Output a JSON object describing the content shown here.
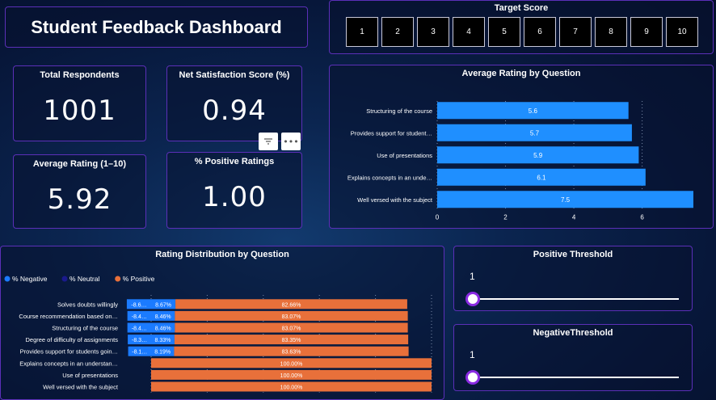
{
  "dashboard": {
    "title": "Student Feedback Dashboard"
  },
  "kpis": {
    "respondents": {
      "label": "Total Respondents",
      "value": "1001"
    },
    "nss": {
      "label": "Net Satisfaction Score (%)",
      "value": "0.94"
    },
    "avg_rating": {
      "label": "Average Rating (1–10)",
      "value": "5.92"
    },
    "pos_ratings": {
      "label": "% Positive Ratings",
      "value": "1.00"
    }
  },
  "visual_tools": {
    "filter_icon": "filter-icon",
    "more_icon": "more-options-icon",
    "more_label": "•••"
  },
  "target_score": {
    "title": "Target Score",
    "options": [
      "1",
      "2",
      "3",
      "4",
      "5",
      "6",
      "7",
      "8",
      "9",
      "10"
    ]
  },
  "avg_by_question": {
    "title": "Average Rating by Question",
    "chart_data": {
      "type": "bar",
      "orientation": "horizontal",
      "categories": [
        "Structuring of the course",
        "Provides support for student…",
        "Use of presentations",
        "Explains concepts in an unde…",
        "Well versed with the subject"
      ],
      "values": [
        5.6,
        5.7,
        5.9,
        6.1,
        7.5
      ],
      "value_labels": [
        "5.6",
        "5.7",
        "5.9",
        "6.1",
        "7.5"
      ],
      "xlim": [
        0,
        7.5
      ],
      "xticks": [
        "0",
        "2",
        "4",
        "6"
      ],
      "xtick_values": [
        0,
        2,
        4,
        6
      ],
      "color": "#1f8fff",
      "grid": true
    }
  },
  "distribution": {
    "title": "Rating Distribution by Question",
    "legend": [
      {
        "label": "% Negative",
        "color": "#1b7bff"
      },
      {
        "label": "% Neutral",
        "color": "#1a1a8c"
      },
      {
        "label": "% Positive",
        "color": "#e8703a"
      }
    ],
    "chart_data": {
      "type": "bar",
      "stacked": true,
      "orientation": "horizontal",
      "categories": [
        "Solves doubts willingly",
        "Course recommendation based on…",
        "Structuring of the course",
        "Degree of difficulty of assignments",
        "Provides support for students goin…",
        "Explains concepts in an understan…",
        "Use of presentations",
        "Well versed with the subject"
      ],
      "series": [
        {
          "name": "% Negative",
          "values": [
            8.67,
            8.46,
            8.46,
            8.33,
            8.19,
            0,
            0,
            0
          ],
          "labels": [
            "-8.6…",
            "-8.4…",
            "-8.4…",
            "-8.3…",
            "-8.1…",
            "",
            "",
            ""
          ]
        },
        {
          "name": "% Neutral",
          "values": [
            8.67,
            8.46,
            8.46,
            8.33,
            8.19,
            0,
            0,
            0
          ],
          "labels": [
            "8.67%",
            "8.46%",
            "8.46%",
            "8.33%",
            "8.19%",
            "",
            "",
            ""
          ]
        },
        {
          "name": "% Positive",
          "values": [
            82.66,
            83.07,
            83.07,
            83.35,
            83.63,
            100,
            100,
            100
          ],
          "labels": [
            "82.66%",
            "83.07%",
            "83.07%",
            "83.35%",
            "83.63%",
            "100.00%",
            "100.00%",
            "100.00%"
          ]
        }
      ],
      "xlim": [
        0,
        100
      ],
      "xticks": [
        "0%",
        "20%",
        "40%",
        "60%",
        "80%",
        "100%"
      ],
      "colors": {
        "negative": "#1b7bff",
        "neutral": "#1a1a8c",
        "positive": "#e8703a"
      }
    }
  },
  "positive_threshold": {
    "title": "Positive Threshold",
    "value": "1"
  },
  "negative_threshold": {
    "title": "NegativeThreshold",
    "value": "1"
  }
}
